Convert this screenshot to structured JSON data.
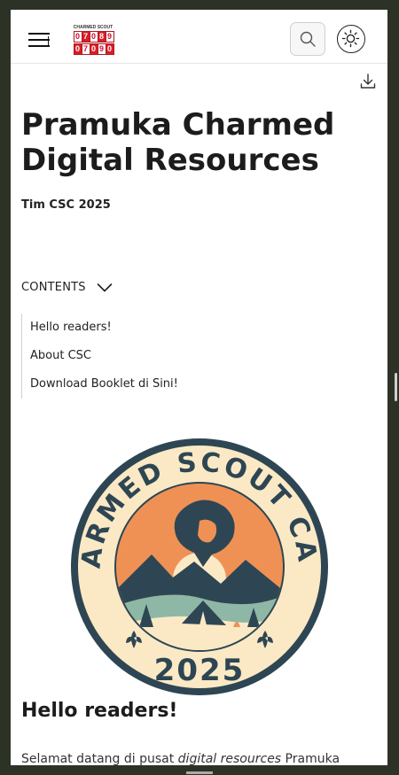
{
  "header": {
    "menu_icon": "hamburger-icon",
    "logo": {
      "title": "CHARMED SCOUT",
      "row1": [
        "0",
        "7",
        "0",
        "8",
        "9"
      ],
      "row2": [
        "0",
        "7",
        "0",
        "9",
        "0"
      ],
      "digit_color": "#c8102e"
    },
    "search_icon": "search-icon",
    "theme_icon": "sun-icon"
  },
  "toolbar": {
    "download_icon": "download-icon"
  },
  "document": {
    "title": "Pramuka Charmed Digital Resources",
    "author": "Tim CSC 2025"
  },
  "contents": {
    "label": "CONTENTS",
    "items": [
      {
        "label": "Hello readers!"
      },
      {
        "label": "About CSC"
      },
      {
        "label": "Download Booklet di Sini!"
      }
    ]
  },
  "badge": {
    "top_text": "CHARMED SCOUT CAMP",
    "year": "2025",
    "colors": {
      "ring": "#2e4653",
      "cream": "#fbe9c5",
      "sunset": "#ef9155",
      "lake": "#8fb7a6"
    }
  },
  "section": {
    "heading": "Hello readers!",
    "para_prefix": "Selamat datang di pusat ",
    "para_italic": "digital resources",
    "para_suffix": " Pramuka"
  }
}
